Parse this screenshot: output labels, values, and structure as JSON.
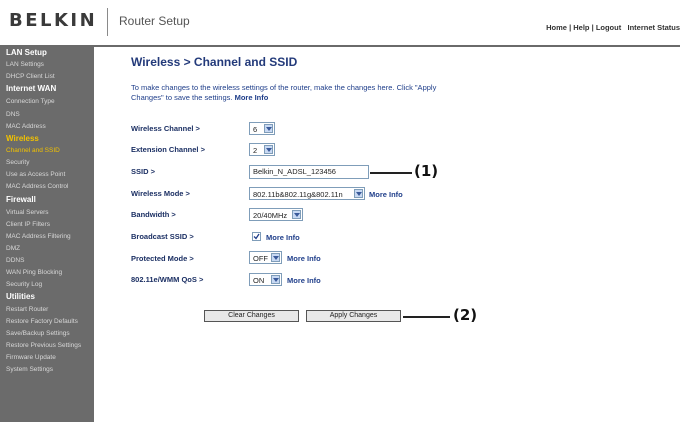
{
  "header": {
    "logo": "BELKIN",
    "app_title": "Router Setup",
    "links": {
      "home": "Home",
      "help": "Help",
      "logout": "Logout",
      "internet_status": "Internet Status"
    },
    "separator": " | "
  },
  "sidebar": {
    "lan_setup": "LAN Setup",
    "lan_settings": "LAN Settings",
    "dhcp_client_list": "DHCP Client List",
    "internet_wan": "Internet WAN",
    "connection_type": "Connection Type",
    "dns": "DNS",
    "mac_address": "MAC Address",
    "wireless": "Wireless",
    "channel_and_ssid": "Channel and SSID",
    "security": "Security",
    "use_as_access_point": "Use as Access Point",
    "mac_address_control": "MAC Address Control",
    "firewall": "Firewall",
    "virtual_servers": "Virtual Servers",
    "client_ip_filters": "Client IP Filters",
    "mac_address_filtering": "MAC Address Filtering",
    "dmz": "DMZ",
    "ddns": "DDNS",
    "wan_ping_blocking": "WAN Ping Blocking",
    "security_log": "Security Log",
    "utilities": "Utilities",
    "restart_router": "Restart Router",
    "restore_factory_defaults": "Restore Factory Defaults",
    "save_backup_settings": "Save/Backup Settings",
    "restore_previous_settings": "Restore Previous Settings",
    "firmware_update": "Firmware Update",
    "system_settings": "System Settings"
  },
  "main": {
    "title": "Wireless > Channel and SSID",
    "intro": "To make changes to the wireless settings of the router, make the changes here. Click \"Apply Changes\" to save the settings.",
    "intro_more": "More Info",
    "fields": {
      "wireless_channel": {
        "label": "Wireless Channel >",
        "value": "6"
      },
      "extension_channel": {
        "label": "Extension Channel >",
        "value": "2"
      },
      "ssid": {
        "label": "SSID >",
        "value": "Belkin_N_ADSL_123456"
      },
      "wireless_mode": {
        "label": "Wireless Mode >",
        "value": "802.11b&802.11g&802.11n",
        "more": "More Info"
      },
      "bandwidth": {
        "label": "Bandwidth >",
        "value": "20/40MHz"
      },
      "broadcast_ssid": {
        "label": "Broadcast SSID >",
        "checked": true,
        "more": "More Info"
      },
      "protected_mode": {
        "label": "Protected Mode >",
        "value": "OFF",
        "more": "More Info"
      },
      "wmm_qos": {
        "label": "802.11e/WMM QoS >",
        "value": "ON",
        "more": "More Info"
      }
    },
    "buttons": {
      "clear": "Clear Changes",
      "apply": "Apply Changes"
    }
  },
  "callouts": {
    "one": "(1)",
    "two": "(2)"
  }
}
